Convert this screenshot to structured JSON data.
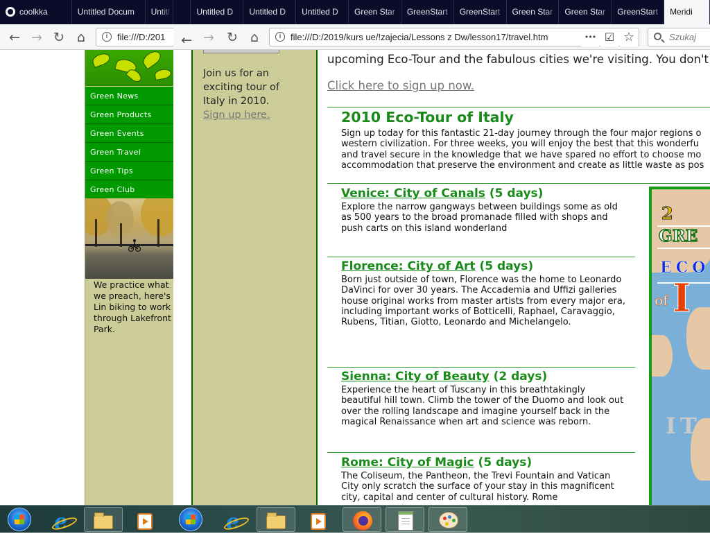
{
  "tabs": [
    {
      "label": "coolkka",
      "icon": "github-icon"
    },
    {
      "label": "Untitled Docum"
    },
    {
      "label": "Untitl"
    },
    {
      "label": "Untitled D"
    },
    {
      "label": "Untitled D"
    },
    {
      "label": "Untitled D"
    },
    {
      "label": "Green Star"
    },
    {
      "label": "GreenStart"
    },
    {
      "label": "GreenStart"
    },
    {
      "label": "Green Star"
    },
    {
      "label": "Green Star"
    },
    {
      "label": "GreenStart"
    },
    {
      "label": "Meridi",
      "active": true
    }
  ],
  "nav": {
    "back": "←",
    "forward": "→",
    "reload": "↻",
    "home": "⌂",
    "left_url": "file:///D:/201",
    "right_url": "file:///D:/2019/kurs ue/!zajecia/Lessons z Dw/lesson17/travel.htm",
    "more": "•••",
    "pocket": "☑",
    "bookmark": "☆",
    "search_placeholder": "Szukaj",
    "splitter": "‹"
  },
  "left_page": {
    "menu": [
      "Green News",
      "Green Products",
      "Green Events",
      "Green Travel",
      "Green Tips",
      "Green Club"
    ],
    "caption": "We practice what we preach, here's Lin biking to work through Lakefront Park."
  },
  "right_page": {
    "sidebar_text": "Join us for an exciting tour of Italy in 2010.",
    "sidebar_link": "Sign up here.",
    "intro": "upcoming Eco-Tour and the fabulous cities we're visiting. You don't w",
    "signup_link": "Click here to sign up now.",
    "tour_title": "2010 Eco-Tour of Italy",
    "tour_lines": [
      "Sign up today for this fantastic 21-day journey through the four major regions o",
      "western civilization. For three weeks, you will enjoy the best that this wonderfu",
      "and travel secure in the knowledge that we have spared no effort to choose mo",
      "accommodation that preserve the environment and create as little waste as pos"
    ],
    "cities": [
      {
        "name": "Venice: City of Canals",
        "days": "(5 days)",
        "text": "Explore the narrow gangways between buildings some as old as 500 years to the broad promanade filled with shops and push carts on this island wonderland"
      },
      {
        "name": "Florence: City of Art",
        "days": "(5 days)",
        "text": "Born just outside of town, Florence was the home to Leonardo DaVinci for over 30 years. The Accademia and Uffizi galleries house original works from master artists from every major era, including important works of Botticelli, Raphael, Caravaggio, Rubens, Titian, Giotto, Leonardo and Michelangelo."
      },
      {
        "name": "Sienna: City of Beauty",
        "days": "(2 days)",
        "text": "Experience the heart of Tuscany in this breathtakingly beautiful hill town. Climb the tower of the Duomo and look out over the rolling landscape and imagine yourself back in the magical Renaissance when art and science was reborn."
      },
      {
        "name": "Rome: City of Magic",
        "days": "(5 days)",
        "text": "The Coliseum, the Pantheon, the Trevi Fountain and Vatican City only scratch the surface of your stay in this magnificent city, capital and center of cultural history. Rome"
      }
    ],
    "poster": {
      "line1": "2",
      "line2": "GRE",
      "line3": "ECO",
      "line4": "of",
      "line5": "I",
      "line6": "IT"
    }
  },
  "taskbar": {
    "items": [
      "start-orb",
      "internet-explorer-icon",
      "explorer-folder-icon",
      "media-player-icon",
      "start-orb",
      "internet-explorer-icon",
      "explorer-folder-icon",
      "media-player-icon",
      "firefox-icon",
      "notepad-plus-icon",
      "paint-icon"
    ]
  }
}
